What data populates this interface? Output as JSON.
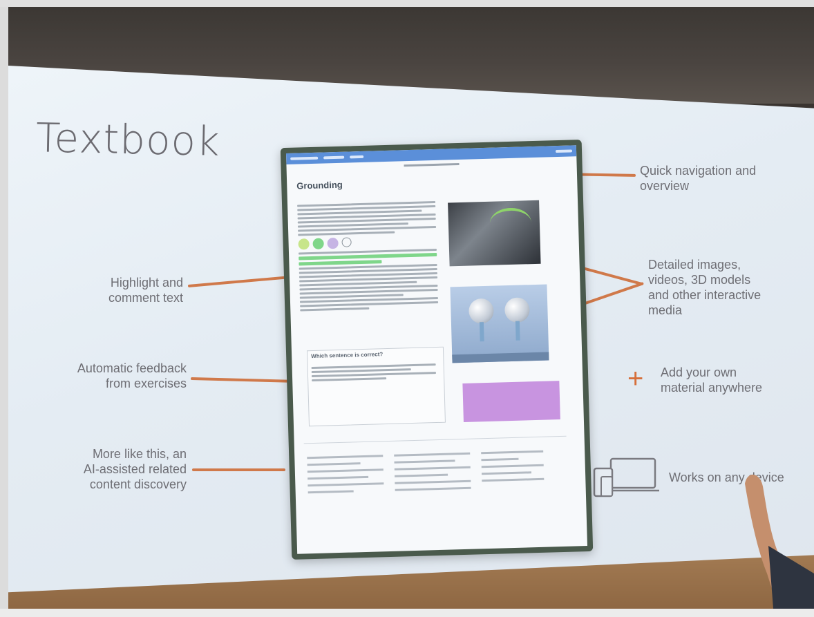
{
  "slide": {
    "title": "Textbook",
    "callouts": {
      "highlight": "Highlight and\ncomment text",
      "feedback": "Automatic feedback\nfrom exercises",
      "more_like": "More like this, an\nAI-assisted related\ncontent discovery",
      "navigation": "Quick navigation and\noverview",
      "media": "Detailed images,\nvideos, 3D models\nand other interactive\nmedia",
      "own_material": "Add your own\nmaterial anywhere",
      "any_device": "Works on any device"
    }
  },
  "tablet": {
    "heading": "Grounding",
    "quiz_question": "Which sentence is correct?"
  },
  "colors": {
    "arrow": "#d0794a",
    "plus": "#d66f3a",
    "highlight": "#7fd68a",
    "purple_card": "#c894e0"
  }
}
